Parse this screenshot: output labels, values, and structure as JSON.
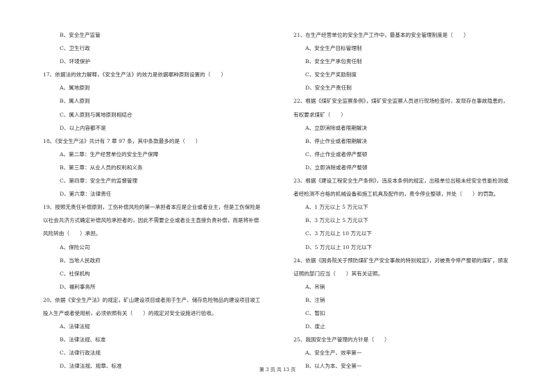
{
  "left": [
    {
      "type": "opt",
      "text": "B、安全生产监管"
    },
    {
      "type": "opt",
      "text": "C、卫生行政"
    },
    {
      "type": "opt",
      "text": "D、环境保护"
    },
    {
      "type": "q",
      "text": "17、依据法的效力解释，《安全生产法》的效力是依据哪种原则设置的（　　）"
    },
    {
      "type": "opt",
      "text": "A、属地原则"
    },
    {
      "type": "opt",
      "text": "B、属人原则"
    },
    {
      "type": "opt",
      "text": "C、属人原则与属地原则相结合"
    },
    {
      "type": "opt",
      "text": "D、以上内容都不是"
    },
    {
      "type": "q",
      "text": "18、《安全生产法》共计有 7 章 97 条，其中条款最多的是（　　）"
    },
    {
      "type": "opt",
      "text": "A、第二章：生产经营单位的安全生产保障"
    },
    {
      "type": "opt",
      "text": "B、第三章：从业人员的权利和义务"
    },
    {
      "type": "opt",
      "text": "C、第四章：安全生产的监督管理"
    },
    {
      "type": "opt",
      "text": "D、第六章：法律责任"
    },
    {
      "type": "q",
      "text": "19、按照无责任补偿原则，工伤补偿风险的第一承担者本应是企业或者业主，但是工伤保险是"
    },
    {
      "type": "q",
      "text": "以社会共济方式确定补偿风险承担者的，因此不需要企业或者业主直接负责补偿，而是将补偿"
    },
    {
      "type": "q",
      "text": "风险转由（　　）承担。"
    },
    {
      "type": "opt",
      "text": "A、保险公司"
    },
    {
      "type": "opt",
      "text": "B、当地人民政府"
    },
    {
      "type": "opt",
      "text": "C、社保机构"
    },
    {
      "type": "opt",
      "text": "D、福利事务所"
    },
    {
      "type": "q",
      "text": "20、依据《安全生产法》的规定，矿山建设项目或者用于生产、储存危险物品的建设项目竣工"
    },
    {
      "type": "q",
      "text": "投入生产或者使用前，必须依照有关（　　）的规定对安全设施进行验收。"
    },
    {
      "type": "opt",
      "text": "A、法律法规"
    },
    {
      "type": "opt",
      "text": "B、法律法规、标准"
    },
    {
      "type": "opt",
      "text": "C、法律行政法规"
    },
    {
      "type": "opt",
      "text": "D、法律法规、规章、标准"
    }
  ],
  "right": [
    {
      "type": "q",
      "text": "21、在生产经营单位的安全生产工作中，最基本的安全管理制度是（　　）"
    },
    {
      "type": "opt",
      "text": "A、安全生产目标管理制"
    },
    {
      "type": "opt",
      "text": "B、安全生产承包责任制"
    },
    {
      "type": "opt",
      "text": "C、安全生产奖励制度"
    },
    {
      "type": "opt",
      "text": "D、安全生产责任制"
    },
    {
      "type": "q",
      "text": "22、根据《煤矿安全监察条例》，煤矿安全监察人员进行现场检查时，发现存在事故隐患的，"
    },
    {
      "type": "q",
      "text": "有权要求煤矿（　　）"
    },
    {
      "type": "opt",
      "text": "A、立即消除或者限期解决"
    },
    {
      "type": "opt",
      "text": "B、停止作业或者限期解决"
    },
    {
      "type": "opt",
      "text": "C、停止作业或者停产整顿"
    },
    {
      "type": "opt",
      "text": "D、立即消除或者停产整顿"
    },
    {
      "type": "q",
      "text": "23、根据《建设工程安全生产条例》，违反本条例的规定，出租单位出租未经安全性能检测或"
    },
    {
      "type": "q",
      "text": "者经检测不合格的机械设备和施工机具及配件的，责令停业整顿，并处（　　）的罚款。"
    },
    {
      "type": "opt",
      "text": "A、1 万元以上 5 万元以下"
    },
    {
      "type": "opt",
      "text": "B、3 万元以上 5 万元以下"
    },
    {
      "type": "opt",
      "text": "C、3 万元以上 10 万元以下"
    },
    {
      "type": "opt",
      "text": "D、5 万元以上 10 万元以下"
    },
    {
      "type": "q",
      "text": "24、依据《国务院关于预防煤矿生产安全事故的特别规定》，对被责令停产整顿的煤矿，颁发"
    },
    {
      "type": "q",
      "text": "证照的部门应当（　　）其有关证照。"
    },
    {
      "type": "opt",
      "text": "A、吊销"
    },
    {
      "type": "opt",
      "text": "B、注销"
    },
    {
      "type": "opt",
      "text": "C、暂扣"
    },
    {
      "type": "opt",
      "text": "D、废止"
    },
    {
      "type": "q",
      "text": "25、我国安全生产管理的方针是（　　）"
    },
    {
      "type": "opt",
      "text": "A、安全生产、效率第一"
    },
    {
      "type": "opt",
      "text": "B、以人为本、安全第一"
    }
  ],
  "footer": {
    "page_label": "第 3 页 共 13 页"
  }
}
